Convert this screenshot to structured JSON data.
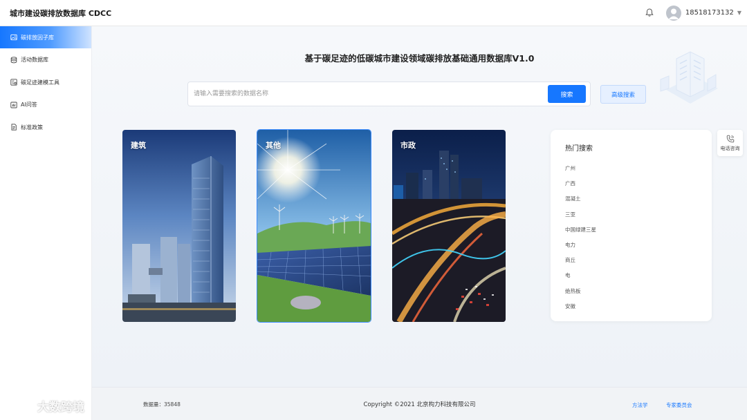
{
  "header": {
    "app_title": "城市建设碳排放数据库 CDCC",
    "username": "18518173132",
    "icons": {
      "bell": "bell-icon",
      "avatar": "user-avatar-icon",
      "dropdown": "caret-down-icon"
    }
  },
  "sidebar": {
    "items": [
      {
        "label": "碳排放因子库",
        "icon": "image-icon",
        "active": true
      },
      {
        "label": "活动数据库",
        "icon": "database-icon",
        "active": false
      },
      {
        "label": "碳足迹建模工具",
        "icon": "tool-icon",
        "active": false
      },
      {
        "label": "AI问答",
        "icon": "ai-icon",
        "active": false
      },
      {
        "label": "标准政策",
        "icon": "document-icon",
        "active": false
      }
    ]
  },
  "main": {
    "title": "基于碳足迹的低碳城市建设领域碳排放基础通用数据库V1.0",
    "search": {
      "placeholder": "请输入需要搜索的数据名称",
      "value": "",
      "button_label": "搜索"
    },
    "advanced_search_label": "高级搜索",
    "categories": [
      {
        "label": "建筑",
        "selected": false
      },
      {
        "label": "其他",
        "selected": true
      },
      {
        "label": "市政",
        "selected": false
      }
    ],
    "hot_search": {
      "title": "热门搜索",
      "items": [
        "广州",
        "广西",
        "混凝土",
        "三亚",
        "中国绿建三星",
        "电力",
        "商丘",
        "电",
        "绝热板",
        "安徽"
      ]
    }
  },
  "float_contact": {
    "label": "电话咨询",
    "icon": "phone-icon"
  },
  "footer": {
    "data_count": "数据量：35848",
    "copyright": "Copyright ©2021 北京构力科技有限公司",
    "links": [
      "方法学",
      "专家委员会"
    ]
  },
  "watermark": {
    "text": "大数跨境"
  },
  "colors": {
    "primary": "#1677ff",
    "background": "#f4f6f9",
    "sidebar_active": "#1677ff"
  }
}
